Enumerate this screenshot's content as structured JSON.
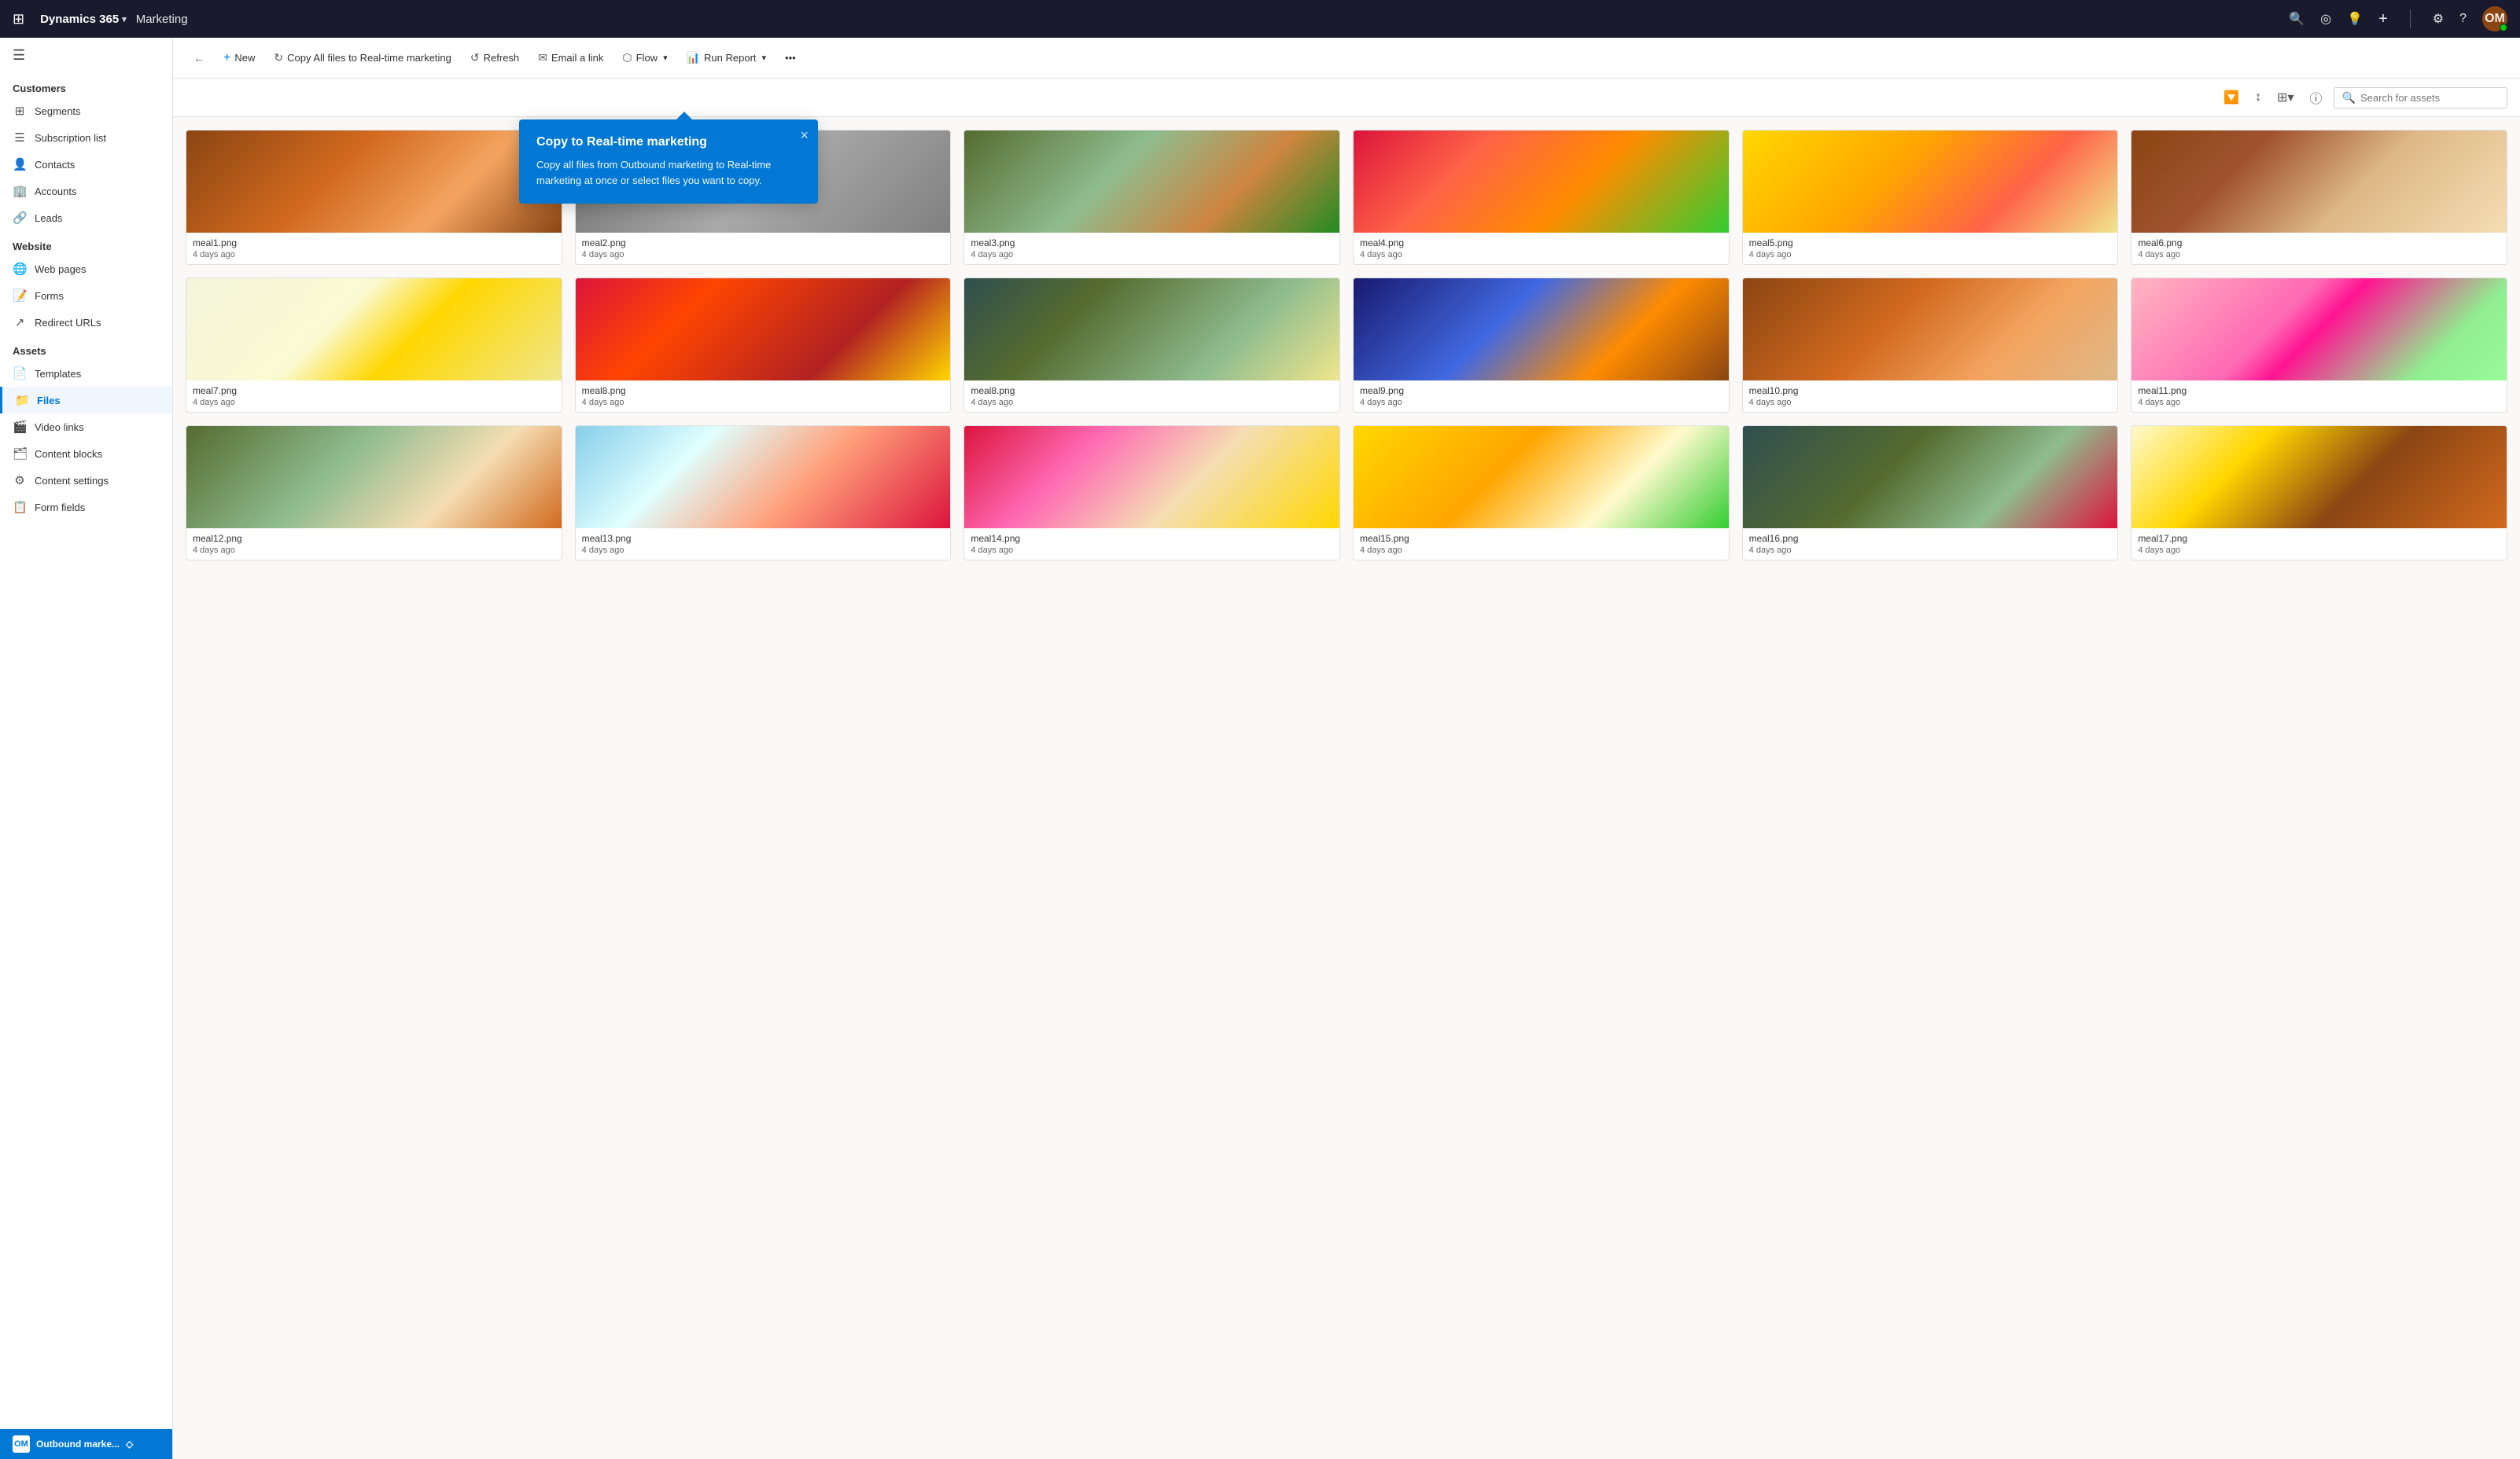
{
  "topNav": {
    "waffle": "⊞",
    "brand": "Dynamics 365",
    "brandChevron": "▾",
    "app": "Marketing",
    "icons": {
      "search": "🔍",
      "target": "◎",
      "bulb": "💡",
      "plus": "+",
      "settings": "⚙",
      "help": "?"
    },
    "avatar": "OM",
    "avatarBg": "#8b4513"
  },
  "sidebar": {
    "hamburger": "☰",
    "sections": [
      {
        "label": "Customers",
        "items": [
          {
            "id": "segments",
            "icon": "⊞",
            "label": "Segments"
          },
          {
            "id": "subscription-list",
            "icon": "📋",
            "label": "Subscription list"
          },
          {
            "id": "contacts",
            "icon": "👤",
            "label": "Contacts"
          },
          {
            "id": "accounts",
            "icon": "🏢",
            "label": "Accounts"
          },
          {
            "id": "leads",
            "icon": "🔗",
            "label": "Leads"
          }
        ]
      },
      {
        "label": "Website",
        "items": [
          {
            "id": "web-pages",
            "icon": "🌐",
            "label": "Web pages"
          },
          {
            "id": "forms",
            "icon": "📝",
            "label": "Forms"
          },
          {
            "id": "redirect-urls",
            "icon": "↗",
            "label": "Redirect URLs"
          }
        ]
      },
      {
        "label": "Assets",
        "items": [
          {
            "id": "templates",
            "icon": "📄",
            "label": "Templates"
          },
          {
            "id": "files",
            "icon": "📁",
            "label": "Files",
            "active": true
          },
          {
            "id": "video-links",
            "icon": "🎬",
            "label": "Video links"
          },
          {
            "id": "content-blocks",
            "icon": "🗂",
            "label": "Content blocks"
          },
          {
            "id": "content-settings",
            "icon": "⚙",
            "label": "Content settings"
          },
          {
            "id": "form-fields",
            "icon": "📋",
            "label": "Form fields"
          }
        ]
      }
    ],
    "bottom": {
      "label": "Outbound marke...",
      "icon": "OM",
      "chevron": "◇"
    }
  },
  "toolbar": {
    "back": "←",
    "new": "+ New",
    "copyAllFiles": "Copy All files to Real-time marketing",
    "refresh": "Refresh",
    "emailLink": "Email a link",
    "flow": "Flow",
    "runReport": "Run Report",
    "more": "•••"
  },
  "gridToolbar": {
    "filterIcon": "🔽",
    "sortIcon": "↕",
    "viewIcon": "⊞",
    "infoIcon": "ⓘ",
    "searchPlaceholder": "Search for assets"
  },
  "popup": {
    "title": "Copy to Real-time marketing",
    "text": "Copy all files from Outbound marketing to Real-time marketing at once or select files you want to copy.",
    "close": "×"
  },
  "files": [
    {
      "id": "meal1",
      "name": "meal1.png",
      "date": "4 days ago",
      "cssClass": "meal1"
    },
    {
      "id": "meal2",
      "name": "meal2.png",
      "date": "4 days ago",
      "cssClass": "meal2"
    },
    {
      "id": "meal3",
      "name": "meal3.png",
      "date": "4 days ago",
      "cssClass": "meal3"
    },
    {
      "id": "meal4",
      "name": "meal4.png",
      "date": "4 days ago",
      "cssClass": "meal4"
    },
    {
      "id": "meal5",
      "name": "meal5.png",
      "date": "4 days ago",
      "cssClass": "meal5"
    },
    {
      "id": "meal6",
      "name": "meal6.png",
      "date": "4 days ago",
      "cssClass": "meal6"
    },
    {
      "id": "meal7",
      "name": "meal7.png",
      "date": "4 days ago",
      "cssClass": "meal7"
    },
    {
      "id": "meal8a",
      "name": "meal8.png",
      "date": "4 days ago",
      "cssClass": "meal8a"
    },
    {
      "id": "meal8b",
      "name": "meal8.png",
      "date": "4 days ago",
      "cssClass": "meal8b"
    },
    {
      "id": "meal9",
      "name": "meal9.png",
      "date": "4 days ago",
      "cssClass": "meal9"
    },
    {
      "id": "meal10",
      "name": "meal10.png",
      "date": "4 days ago",
      "cssClass": "meal10"
    },
    {
      "id": "meal11",
      "name": "meal11.png",
      "date": "4 days ago",
      "cssClass": "meal11"
    },
    {
      "id": "meal12",
      "name": "meal12.png",
      "date": "4 days ago",
      "cssClass": "meal12"
    },
    {
      "id": "meal13",
      "name": "meal13.png",
      "date": "4 days ago",
      "cssClass": "meal13"
    },
    {
      "id": "meal14",
      "name": "meal14.png",
      "date": "4 days ago",
      "cssClass": "meal14"
    },
    {
      "id": "meal15",
      "name": "meal15.png",
      "date": "4 days ago",
      "cssClass": "meal15"
    },
    {
      "id": "meal16",
      "name": "meal16.png",
      "date": "4 days ago",
      "cssClass": "meal16"
    },
    {
      "id": "meal17",
      "name": "meal17.png",
      "date": "4 days ago",
      "cssClass": "meal17"
    }
  ]
}
